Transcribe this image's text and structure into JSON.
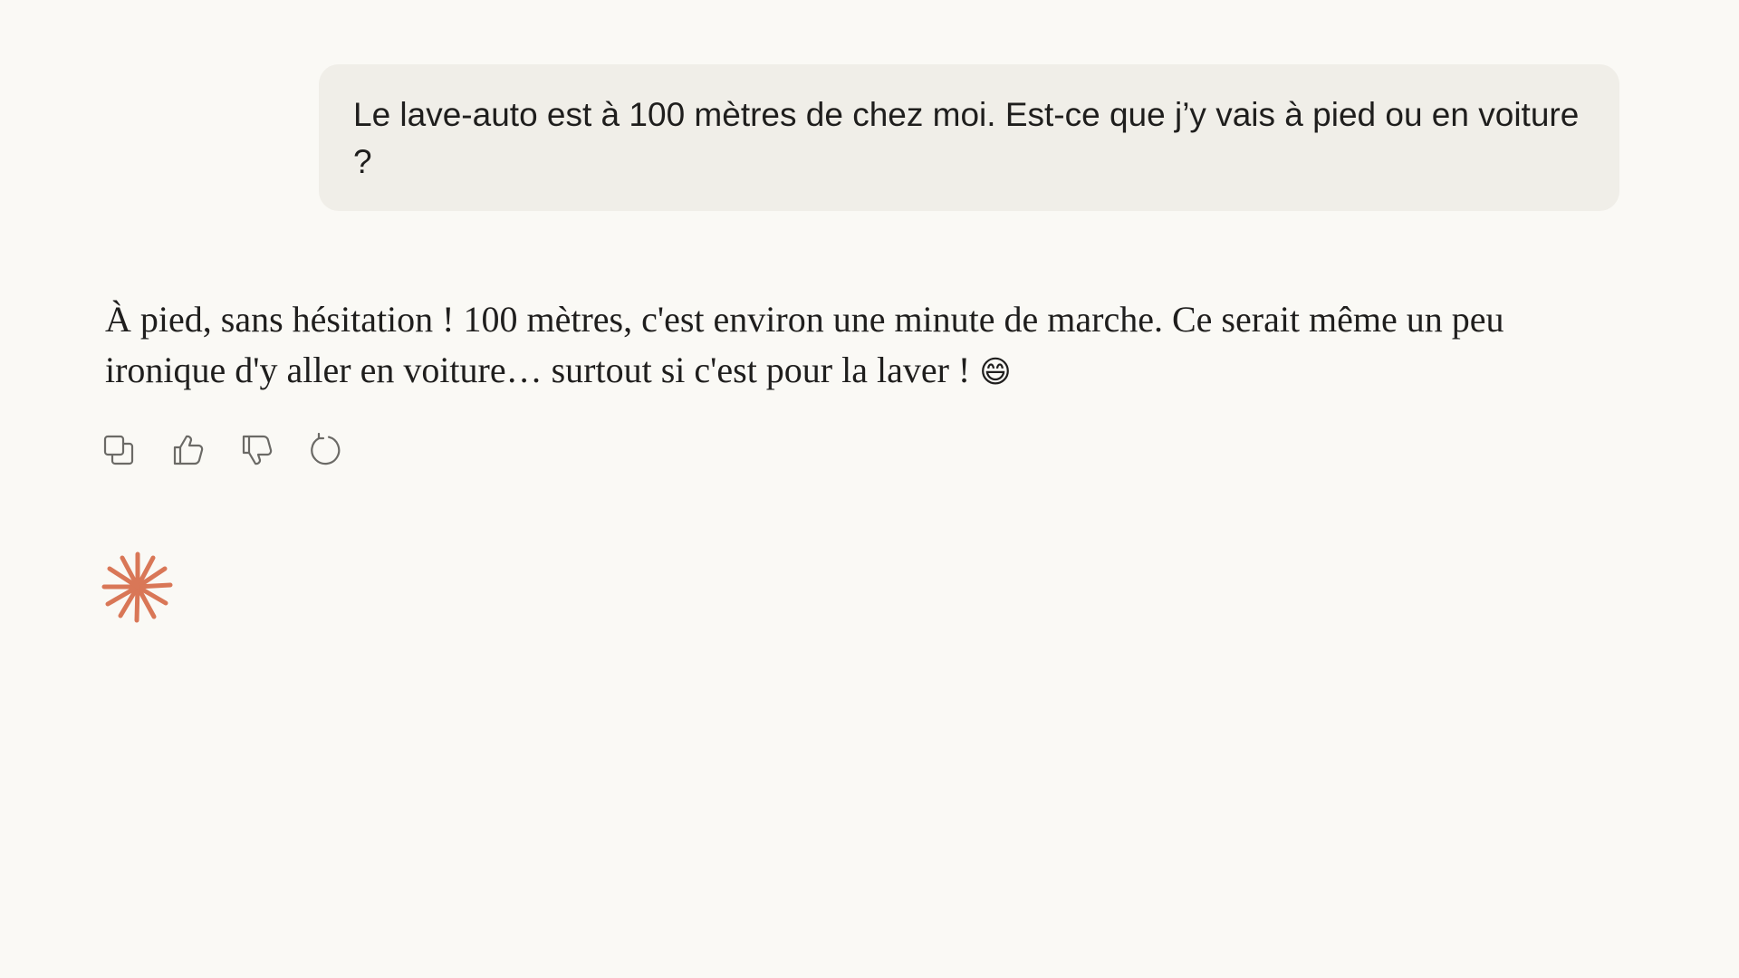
{
  "conversation": {
    "user_message": "Le lave-auto est à 100 mètres de chez moi. Est-ce que j’y vais à pied ou en voiture ?",
    "assistant_message": "À pied, sans hésitation ! 100 mètres, c'est environ une minute de marche. Ce serait même un peu ironique d'y aller en voiture… surtout si c'est pour la laver !",
    "assistant_emoji": "😄"
  },
  "actions": {
    "copy_icon": "copy-icon",
    "thumbs_up_icon": "thumbs-up-icon",
    "thumbs_down_icon": "thumbs-down-icon",
    "retry_icon": "retry-icon"
  },
  "colors": {
    "background": "#faf9f5",
    "user_bubble": "#f0eee8",
    "text": "#1f1e1d",
    "icon": "#6b6a66",
    "accent": "#d97757"
  }
}
